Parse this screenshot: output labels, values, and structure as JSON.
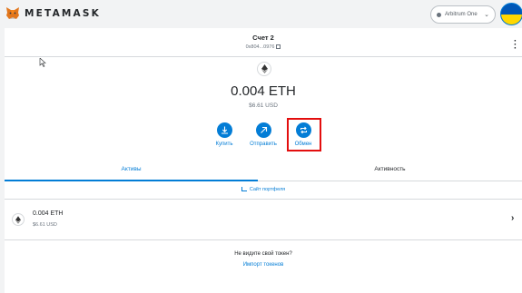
{
  "header": {
    "logo_text": "METAMASK",
    "network_label": "Arbitrum One",
    "network_icon": "network-dot-icon",
    "avatar_icon": "account-avatar-ukraine-flag"
  },
  "account": {
    "name": "Счет 2",
    "address": "0x804...0976",
    "copy_icon": "copy-icon",
    "menu_icon": "kebab-menu-icon"
  },
  "balance": {
    "token_icon": "eth-icon",
    "amount": "0.004 ETH",
    "fiat": "$6.61 USD"
  },
  "actions": [
    {
      "label": "Купить",
      "icon": "download-arrow-icon"
    },
    {
      "label": "Отправить",
      "icon": "send-arrow-icon"
    },
    {
      "label": "Обмен",
      "icon": "swap-icon"
    }
  ],
  "tabs": [
    {
      "label": "Активы",
      "active": true
    },
    {
      "label": "Активность",
      "active": false
    }
  ],
  "portfolio_link": "Сайт портфеля",
  "assets": [
    {
      "amount": "0.004 ETH",
      "fiat": "$6.61 USD",
      "icon": "eth-icon"
    }
  ],
  "footer": {
    "question": "Не видите свой токен?",
    "import_link": "Импорт токенов"
  },
  "colors": {
    "accent": "#037dd6",
    "highlight": "#e30e0e",
    "background": "#f2f3f4"
  }
}
